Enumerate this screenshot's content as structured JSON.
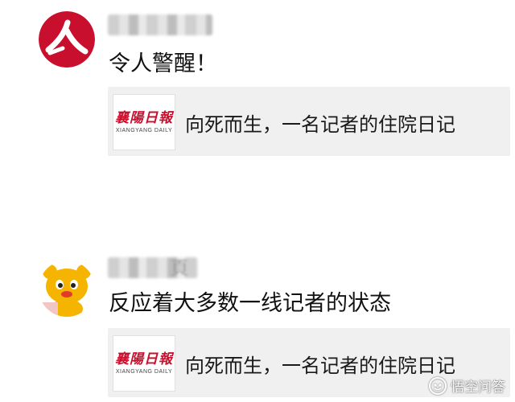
{
  "posts": [
    {
      "avatar_icon": "red-figure-logo-icon",
      "message": "令人警醒！",
      "card": {
        "logo_cn": "襄陽日報",
        "logo_en": "XIANGYANG DAILY",
        "title": "向死而生，一名记者的住院日记"
      }
    },
    {
      "avatar_icon": "yellow-bear-mascot-icon",
      "username_visible_part": "頁",
      "message": "反应着大多数一线记者的状态",
      "card": {
        "logo_cn": "襄陽日報",
        "logo_en": "XIANGYANG DAILY",
        "title": "向死而生，一名记者的住院日记"
      }
    }
  ],
  "watermark": {
    "icon": "wukong-logo-icon",
    "text": "悟空问答"
  },
  "colors": {
    "card_background": "#f0f0f0",
    "logo_red": "#c8102e",
    "avatar_red": "#c8102e",
    "mascot_yellow": "#f5b400"
  }
}
